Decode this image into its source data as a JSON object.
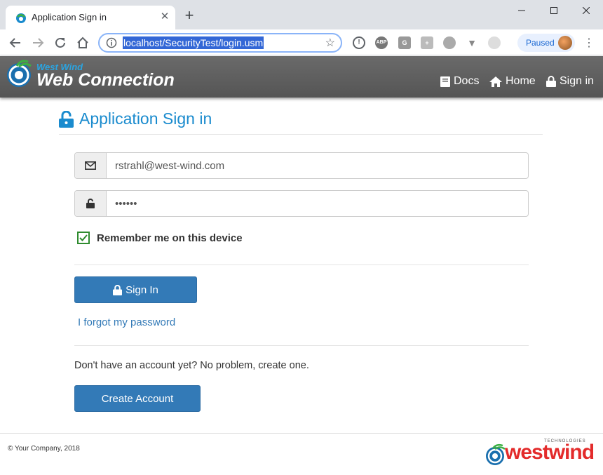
{
  "browser": {
    "tab_title": "Application Sign in",
    "new_tab_symbol": "+",
    "url": "localhost/SecurityTest/login.usm",
    "paused_label": "Paused"
  },
  "header": {
    "brand_small": "West Wind",
    "brand_big": "Web Connection",
    "nav": {
      "docs": "Docs",
      "home": "Home",
      "signin": "Sign in"
    }
  },
  "main": {
    "title": "Application Sign in",
    "email_value": "rstrahl@west-wind.com",
    "password_value": "••••••",
    "remember_label": "Remember me on this device",
    "remember_checked": true,
    "signin_button": "Sign In",
    "forgot_link": "I forgot my password",
    "no_account_text": "Don't have an account yet? No problem, create one.",
    "create_button": "Create Account"
  },
  "footer": {
    "copyright": "© Your Company, 2018",
    "logo_text": "westwind",
    "logo_tagline": "TECHNOLOGIES"
  },
  "colors": {
    "accent": "#1a8bce",
    "button": "#337ab7",
    "header_bg": "#5e5e5e",
    "brand_blue": "#2aa5e2",
    "logo_red": "#e32b2b"
  }
}
